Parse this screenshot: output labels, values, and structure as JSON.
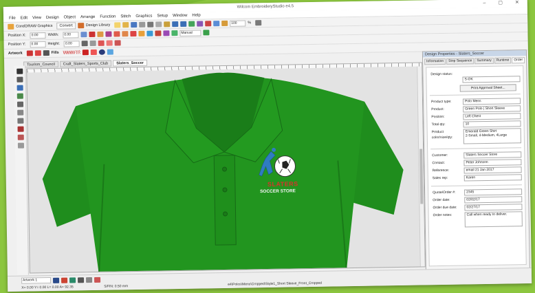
{
  "window": {
    "title": "Wilcom EmbroideryStudio e4.5"
  },
  "menu": [
    "File",
    "Edit",
    "View",
    "Design",
    "Object",
    "Arrange",
    "Function",
    "Stitch",
    "Graphics",
    "Setup",
    "Window",
    "Help"
  ],
  "toolbar": {
    "corel_label": "CorelDRAW Graphics",
    "convert_label": "Convert",
    "design_library_label": "Design Library",
    "zoom_value": "100",
    "zoom_unit": "%",
    "fabric_label": "Fills",
    "style_select": "Manual",
    "artwork_label": "Artwork",
    "position_x_label": "Position X:",
    "position_y_label": "Position Y:",
    "position_x_value": "0.00",
    "position_y_value": "0.00",
    "width_label": "Width:",
    "height_label": "Height:",
    "width_value": "0.00",
    "height_value": "0.00"
  },
  "doc_tabs": [
    {
      "label": "Tourism_Council"
    },
    {
      "label": "Craft_Slaters_Sports_Club"
    },
    {
      "label": "Slaters_Soccer"
    }
  ],
  "design": {
    "logo_line1": "SLATERS",
    "logo_line2": "SOCCER STORE"
  },
  "dock": {
    "title": "Design Properties - Slaters_Soccer",
    "tabs": [
      "Information",
      "Stop Sequence",
      "Summary",
      "Runtime",
      "Order"
    ],
    "design_status_label": "Design status:",
    "design_status_value": "S-OK",
    "print_approval_label": "Print Approval Sheet...",
    "fields": [
      {
        "label": "Product type:",
        "value": "Polo Mens"
      },
      {
        "label": "Product:",
        "value": "Green Polo | Short Sleeve"
      },
      {
        "label": "Position:",
        "value": "Left Chest"
      },
      {
        "label": "Total qty:",
        "value": "10"
      },
      {
        "label": "Product color/size/qty:",
        "value": "Emerald Green Shirt\n2-Small, 4-Medium, 4Large"
      }
    ],
    "customer_fields": [
      {
        "label": "Customer:",
        "value": "Slaters Soccer Store"
      },
      {
        "label": "Contact:",
        "value": "Peter Johnson"
      },
      {
        "label": "Reference:",
        "value": "email 21 Jan 2017"
      },
      {
        "label": "Sales rep:",
        "value": "Karen"
      }
    ],
    "order_fields": [
      {
        "label": "Quote/Order #:",
        "value": "2345"
      },
      {
        "label": "Order date:",
        "value": "02/02/17"
      },
      {
        "label": "Order due date:",
        "value": "02/27/17"
      },
      {
        "label": "Order notes:",
        "value": "Call when ready to deliver."
      }
    ]
  },
  "status": {
    "layer_label": "Artwork 1",
    "coords": "X= 0.00 Y= 0.00 L= 0.00 A= 92.35",
    "stitch_info": "S/FIN: 0.50 mm",
    "file_path": "e4\\Polos\\Mens\\Cropped\\Style1_Short Sleeve_Front_Cropped"
  },
  "colors": {
    "shirt": "#20921e",
    "shirt_dark": "#16701a",
    "background": "#8cc63f",
    "logo_red": "#d7332b",
    "logo_blue": "#2f7cc1"
  }
}
